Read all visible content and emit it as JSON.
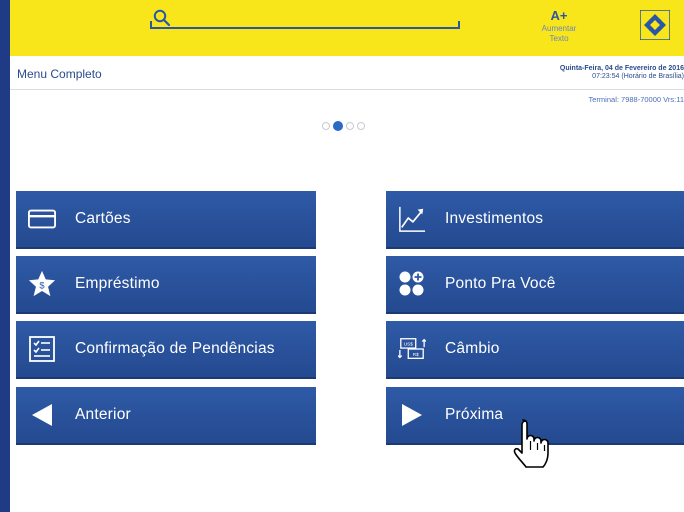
{
  "topbar": {
    "font_size_label": "A+",
    "font_size_caption": "Aumentar Texto",
    "icons": {
      "search": "search-icon",
      "logo": "banco-do-brasil-logo-icon"
    }
  },
  "header": {
    "title": "Menu Completo",
    "date": "Quinta-Feira, 04 de Fevereiro de 2016",
    "time": "07:23:54 (Horário de Brasília)",
    "terminal": "Terminal: 7988-70000 Vrs:11"
  },
  "pager": {
    "pages": 4,
    "current": 2
  },
  "tiles": [
    {
      "label": "Cartões",
      "icon": "credit-card-icon"
    },
    {
      "label": "Investimentos",
      "icon": "chart-up-icon"
    },
    {
      "label": "Empréstimo",
      "icon": "star-dollar-icon"
    },
    {
      "label": "Ponto Pra Você",
      "icon": "dots-plus-icon"
    },
    {
      "label": "Confirmação de Pendências",
      "icon": "checklist-icon"
    },
    {
      "label": "Câmbio",
      "icon": "currency-exchange-icon"
    },
    {
      "label": "Anterior",
      "icon": "arrow-left-icon"
    },
    {
      "label": "Próxima",
      "icon": "arrow-right-icon"
    }
  ],
  "colors": {
    "topbar": "#f8e51a",
    "tile": "#2f5aa6",
    "accent": "#2a56a8",
    "frame": "#1f3b86"
  }
}
